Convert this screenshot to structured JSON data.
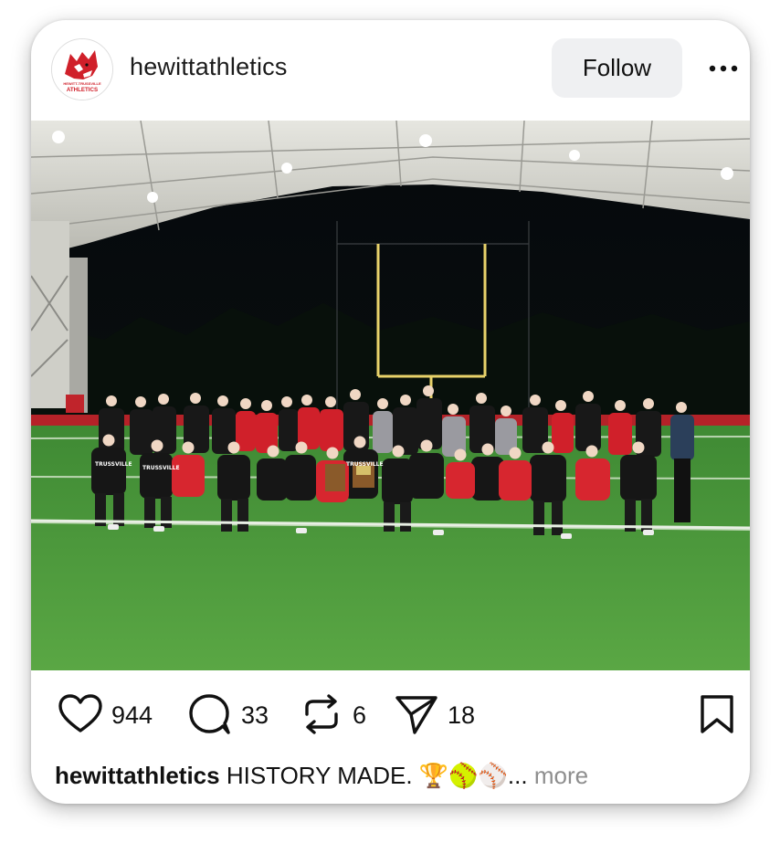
{
  "header": {
    "username": "hewittathletics",
    "follow_label": "Follow",
    "avatar_text_top": "HEWITT-TRUSSVILLE",
    "avatar_text_bottom": "ATHLETICS"
  },
  "photo": {
    "jersey_text": "TRUSSVILLE"
  },
  "actions": {
    "likes": "944",
    "comments": "33",
    "reposts": "6",
    "shares": "18"
  },
  "caption": {
    "user": "hewittathletics",
    "text": "HISTORY MADE.",
    "emojis": "🏆🥎⚾",
    "ellipsis": "...",
    "more_label": "more"
  },
  "colors": {
    "team_red": "#d0202a",
    "turf_green": "#4f9c3a",
    "follow_bg": "#eff0f2",
    "muted_text": "#8e8e8e"
  },
  "icons": [
    "heart-icon",
    "comment-icon",
    "repost-icon",
    "send-icon",
    "bookmark-icon",
    "more-dots-icon"
  ]
}
